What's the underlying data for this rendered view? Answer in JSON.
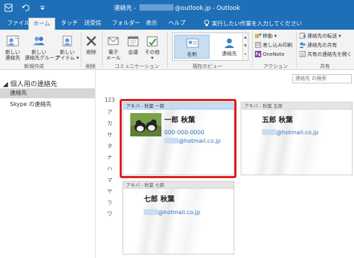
{
  "titlebar": {
    "title_prefix": "連絡先 - ",
    "title_suffix": "@outlook.jp  -  Outlook"
  },
  "tabs": [
    "ファイル",
    "ホーム",
    "タッチ",
    "送受信",
    "フォルダー",
    "表示",
    "ヘルプ"
  ],
  "tell_me": "実行したい作業を入力してください",
  "ribbon": {
    "new_contact": [
      "新しい",
      "連絡先"
    ],
    "new_group": [
      "新しい",
      "連絡先グループ"
    ],
    "new_items": [
      "新しい",
      "アイテム ▾"
    ],
    "delete": "削除",
    "email": [
      "電子",
      "メール"
    ],
    "meeting": "会議",
    "more": [
      "その他",
      "▾"
    ],
    "view_card": "名刺",
    "view_contact": "連絡先",
    "move": "移動 ▾",
    "mail_merge": "差し込み印刷",
    "onenote": "OneNote",
    "forward_contact": "連絡先の転送 ▾",
    "share_contacts": "連絡先の共有",
    "open_shared": "共有の連絡先を開く",
    "groups": {
      "new": "新規作成",
      "delete": "削除",
      "communicate": "コミュニケーション",
      "current_view": "現在のビュー",
      "actions": "アクション",
      "share": "共有"
    }
  },
  "search": {
    "placeholder": "連絡先 の検索"
  },
  "left_pane": {
    "header": "個人用の連絡先",
    "items": [
      "連絡先",
      "Skype の連絡先"
    ]
  },
  "index": [
    "123",
    "ア",
    "カ",
    "サ",
    "タ",
    "ナ",
    "ハ",
    "マ",
    "ヤ",
    "ラ",
    "ワ"
  ],
  "cards": [
    {
      "header": "アキバ - 秋葉 一郎",
      "name": "一郎 秋葉",
      "phone": "000-000-0000",
      "email": "@hotmail.co.jp"
    },
    {
      "header": "アキバ - 秋葉 五郎",
      "name": "五郎 秋葉",
      "email": "@hotmail.co.jp"
    },
    {
      "header": "アキバ - 秋葉 七郎",
      "name": "七郎 秋葉",
      "email": "@hotmail.co.jp"
    }
  ],
  "colors": {
    "accent": "#1f6fb8",
    "highlight": "#e01c1c",
    "link": "#2f73c2"
  }
}
